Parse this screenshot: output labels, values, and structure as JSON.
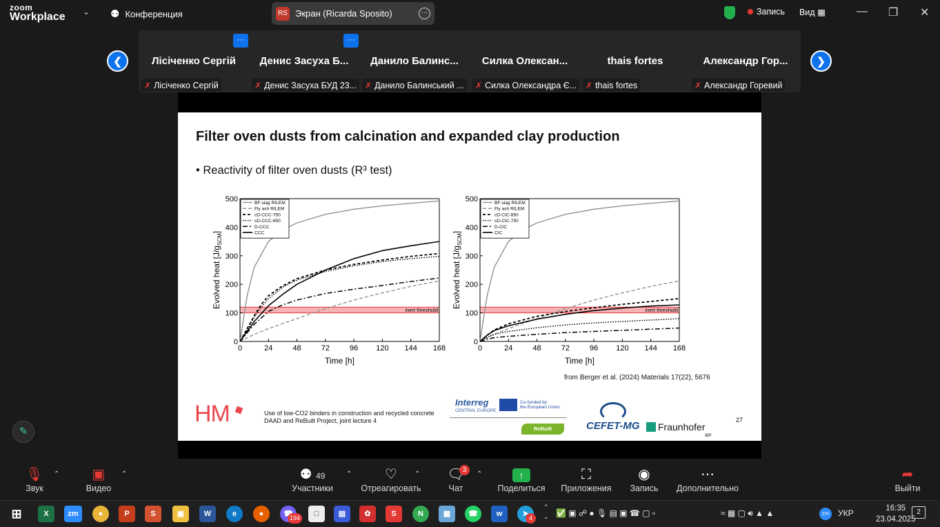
{
  "app": {
    "logo_top": "zoom",
    "logo_bottom": "Workplace",
    "conference_label": "Конференция"
  },
  "share_tab": {
    "initials": "RS",
    "label": "Экран (Ricarda Sposito)"
  },
  "top_right": {
    "record_label": "Запись",
    "view_label": "Вид"
  },
  "participants": [
    {
      "display": "Лісіченко Сергій",
      "label": "Лісіченко Сергій"
    },
    {
      "display": "Денис Засуха Б...",
      "label": "Денис Засуха БУД 23..."
    },
    {
      "display": "Данило Балинс...",
      "label": "Данило Балинський ..."
    },
    {
      "display": "Силка Олексан...",
      "label": "Силка Олександра Є..."
    },
    {
      "display": "thais fortes",
      "label": "thais fortes"
    },
    {
      "display": "Александр Гор...",
      "label": "Александр Горевий"
    }
  ],
  "slide": {
    "title": "Filter oven dusts from calcination and expanded clay production",
    "bullet": "• Reactivity of filter oven dusts (R³ test)",
    "citation": "from Berger et al. (2024) Materials 17(22), 5676",
    "logo_hm": "HM",
    "footer_line1": "Use of low-CO2 binders in construction and recycled concrete",
    "footer_line2": "DAAD and ReBuilt Project, joint lecture 4",
    "interreg": "Interreg",
    "interreg_sub": "CENTRAL EUROPE",
    "eu_line1": "Co-funded by",
    "eu_line2": "the European Union",
    "rebuilt": "ReBuilt",
    "cefet": "CEFET-MG",
    "fraunhofer": "Fraunhofer",
    "ibp": "IBP",
    "page_number": "27"
  },
  "chart_data": [
    {
      "type": "line",
      "xlabel": "Time [h]",
      "ylabel": "Evolved heat [J/g",
      "ylabel_sub": "SCM",
      "ylabel_end": "]",
      "xlim": [
        0,
        168
      ],
      "ylim": [
        0,
        500
      ],
      "xticks": [
        "0",
        "24",
        "48",
        "72",
        "96",
        "120",
        "144",
        "168"
      ],
      "yticks": [
        "0",
        "100",
        "200",
        "300",
        "400",
        "500"
      ],
      "threshold": {
        "label": "inert threshold",
        "from": 100,
        "to": 120
      },
      "legend": [
        "BF-slag RILEM",
        "Fly ash RILEM",
        "cD-CCC-750",
        "cD-CCC-650",
        "D-CCC",
        "CCC"
      ],
      "series": [
        {
          "name": "BF-slag RILEM",
          "x": [
            0,
            6,
            12,
            24,
            36,
            48,
            72,
            96,
            120,
            144,
            168
          ],
          "y": [
            0,
            160,
            260,
            350,
            390,
            415,
            445,
            463,
            475,
            484,
            492
          ]
        },
        {
          "name": "Fly ash RILEM",
          "x": [
            0,
            12,
            24,
            48,
            72,
            96,
            120,
            144,
            168
          ],
          "y": [
            0,
            25,
            45,
            80,
            115,
            145,
            170,
            193,
            212
          ]
        },
        {
          "name": "cD-CCC-750",
          "x": [
            0,
            6,
            12,
            18,
            24,
            36,
            48,
            72,
            96,
            120,
            144,
            168
          ],
          "y": [
            0,
            45,
            90,
            130,
            160,
            195,
            220,
            250,
            270,
            285,
            298,
            308
          ]
        },
        {
          "name": "cD-CCC-650",
          "x": [
            0,
            6,
            12,
            18,
            24,
            36,
            48,
            72,
            96,
            120,
            144,
            168
          ],
          "y": [
            0,
            40,
            85,
            120,
            150,
            190,
            215,
            245,
            265,
            280,
            290,
            298
          ]
        },
        {
          "name": "D-CCC",
          "x": [
            0,
            6,
            12,
            24,
            36,
            48,
            72,
            96,
            120,
            144,
            168
          ],
          "y": [
            0,
            30,
            60,
            105,
            128,
            145,
            168,
            183,
            196,
            210,
            222
          ]
        },
        {
          "name": "CCC",
          "x": [
            0,
            6,
            12,
            24,
            36,
            48,
            72,
            96,
            120,
            144,
            168
          ],
          "y": [
            0,
            35,
            70,
            125,
            165,
            200,
            250,
            290,
            318,
            335,
            350
          ]
        }
      ]
    },
    {
      "type": "line",
      "xlabel": "Time [h]",
      "ylabel": "Evolved heat [J/g",
      "ylabel_sub": "SCM",
      "ylabel_end": "]",
      "xlim": [
        0,
        168
      ],
      "ylim": [
        0,
        500
      ],
      "xticks": [
        "0",
        "24",
        "48",
        "72",
        "96",
        "120",
        "144",
        "168"
      ],
      "yticks": [
        "0",
        "100",
        "200",
        "300",
        "400",
        "500"
      ],
      "threshold": {
        "label": "inert threshold",
        "from": 100,
        "to": 120
      },
      "legend": [
        "BF-slag RILEM",
        "Fly ash RILEM",
        "cD-CIC-850",
        "cD-CIC-750",
        "D-CIC",
        "CIC"
      ],
      "series": [
        {
          "name": "BF-slag RILEM",
          "x": [
            0,
            6,
            12,
            24,
            36,
            48,
            72,
            96,
            120,
            144,
            168
          ],
          "y": [
            0,
            160,
            260,
            350,
            390,
            415,
            445,
            463,
            475,
            484,
            492
          ]
        },
        {
          "name": "Fly ash RILEM",
          "x": [
            0,
            12,
            24,
            48,
            72,
            96,
            120,
            144,
            168
          ],
          "y": [
            0,
            25,
            45,
            80,
            115,
            145,
            170,
            193,
            212
          ]
        },
        {
          "name": "cD-CIC-850",
          "x": [
            0,
            6,
            12,
            24,
            48,
            72,
            96,
            120,
            144,
            168
          ],
          "y": [
            0,
            22,
            40,
            62,
            88,
            105,
            118,
            130,
            140,
            150
          ]
        },
        {
          "name": "cD-CIC-750",
          "x": [
            0,
            6,
            12,
            24,
            48,
            72,
            96,
            120,
            144,
            168
          ],
          "y": [
            0,
            15,
            25,
            35,
            48,
            58,
            65,
            70,
            75,
            80
          ]
        },
        {
          "name": "D-CIC",
          "x": [
            0,
            6,
            12,
            24,
            48,
            72,
            96,
            120,
            144,
            168
          ],
          "y": [
            0,
            8,
            13,
            18,
            25,
            31,
            35,
            39,
            43,
            47
          ]
        },
        {
          "name": "CIC",
          "x": [
            0,
            6,
            12,
            24,
            48,
            72,
            96,
            120,
            144,
            168
          ],
          "y": [
            0,
            22,
            38,
            55,
            78,
            95,
            108,
            117,
            124,
            128
          ]
        }
      ]
    }
  ],
  "toolbar": {
    "audio": "Звук",
    "video": "Видео",
    "participants": "Участники",
    "participants_count": "49",
    "react": "Отреагировать",
    "chat": "Чат",
    "chat_badge": "3",
    "share": "Поделиться",
    "apps": "Приложения",
    "record": "Запись",
    "more": "Дополнительно",
    "leave": "Выйти"
  },
  "taskbar": {
    "badge_viber": "194",
    "badge_telegram": "4",
    "lang": "УКР",
    "time": "16:35",
    "date": "23.04.2025",
    "notif_count": "2"
  }
}
